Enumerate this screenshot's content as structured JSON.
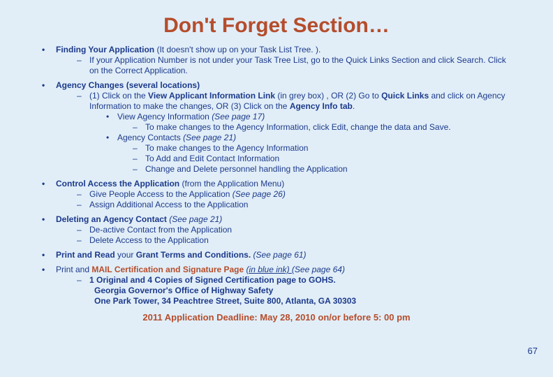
{
  "title": "Don't Forget Section…",
  "pagenum": "67",
  "bullets": [
    {
      "head": "Finding Your Application",
      "tail": "(It doesn't show up on your Task List Tree. ).",
      "sub": "If your Application Number is not under your Task Tree List, go to the Quick Links Section and click Search.  Click on the Correct Application."
    },
    {
      "head": "Agency Changes (several locations)",
      "sub_pre": "(1) Click on the ",
      "sub_bold1": "View Applicant Information Link",
      "sub_mid": " (in grey box) , OR (2) Go to ",
      "sub_bold2": "Quick Links",
      "sub_mid2": " and click on Agency Information to make the changes, OR (3) Click on the ",
      "sub_bold3": "Agency Info tab",
      "sub_end": ".",
      "lvl3a_text": "View Agency Information ",
      "lvl3a_italic": "(See page 17)",
      "lvl4a": "To make changes to the Agency Information, click Edit, change the data and Save.",
      "lvl3b_text": "Agency Contacts ",
      "lvl3b_italic": "(See page 21)",
      "lvl4b1": "To make changes to the Agency Information",
      "lvl4b2": "To Add and Edit Contact Information",
      "lvl4b3": "Change and Delete personnel handling the Application"
    },
    {
      "head": "Control Access the Application",
      "tail": "(from the Application Menu)",
      "sub1_text": "Give People Access to the Application ",
      "sub1_italic": "(See page 26)",
      "sub2": "Assign Additional Access to the Application"
    },
    {
      "head": "Deleting an Agency Contact ",
      "head_italic": "(See page 21)",
      "sub1": "De-active Contact from the Application",
      "sub2": "Delete Access to the Application"
    },
    {
      "pre_bold": "Print and Read ",
      "pre_plain": "your ",
      "mid_bold": "Grant Terms and Conditions. ",
      "tail_italic": "(See page 61)"
    },
    {
      "pre": "Print and ",
      "highlight": "MAIL Certification and Signature Page ",
      "blueink": "(in blue ink) ",
      "tail_italic": "(See page 64)",
      "sub_bold": "1 Original and 4 Copies of Signed Certification page to GOHS.",
      "addr1": "Georgia Governor's Office of Highway Safety",
      "addr2": "One Park Tower, 34 Peachtree Street, Suite 800,  Atlanta, GA 30303"
    }
  ],
  "deadline": "2011 Application Deadline:  May 28, 2010 on/or before 5: 00 pm"
}
